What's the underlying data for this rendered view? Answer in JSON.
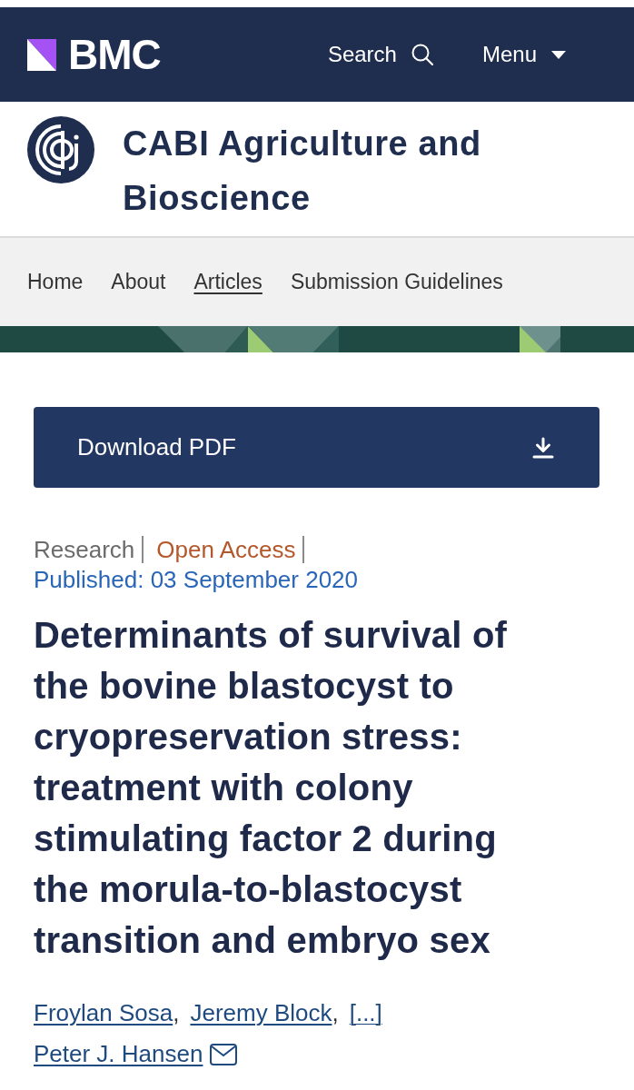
{
  "header": {
    "brand": "BMC",
    "search": "Search",
    "menu": "Menu"
  },
  "journal": {
    "title": "CABI Agriculture and Bioscience"
  },
  "nav": [
    {
      "label": "Home",
      "selected": false
    },
    {
      "label": "About",
      "selected": false
    },
    {
      "label": "Articles",
      "selected": true
    },
    {
      "label": "Submission Guidelines",
      "selected": false
    }
  ],
  "download_button": {
    "label": "Download PDF"
  },
  "article": {
    "type": "Research",
    "access": "Open Access",
    "published": "Published: 03 September 2020",
    "title": "Determinants of survival of the bovine blastocyst to cryopreservation stress: treatment with colony stimulating factor 2 during the morula-to-blastocyst transition and embryo sex",
    "authors": [
      {
        "kind": "author",
        "name": "Froylan Sosa",
        "separator": ","
      },
      {
        "kind": "author",
        "name": "Jeremy Block",
        "separator": ","
      },
      {
        "kind": "more",
        "name": "[...]"
      },
      {
        "kind": "author",
        "name": "Peter J. Hansen",
        "email": true
      }
    ]
  }
}
